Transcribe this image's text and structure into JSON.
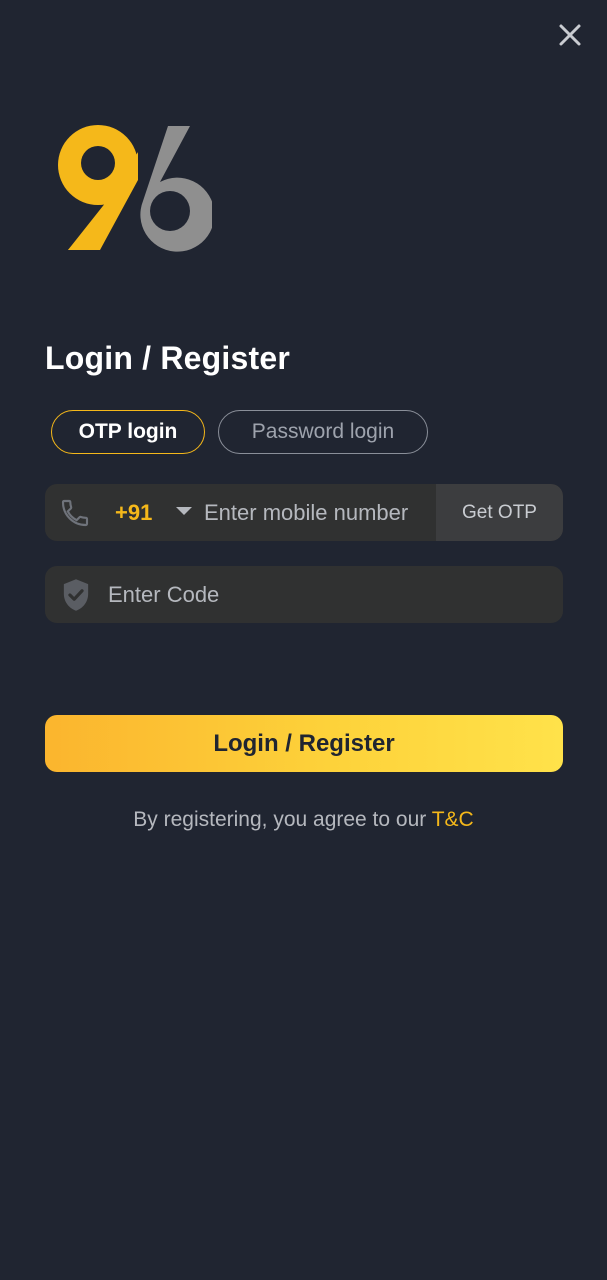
{
  "header": {
    "close_icon": "close-icon"
  },
  "brand": {
    "logo_text": "96",
    "accent_color": "#f5b81a",
    "secondary_color": "#8f8f8f"
  },
  "title": "Login / Register",
  "tabs": [
    {
      "label": "OTP login",
      "active": true
    },
    {
      "label": "Password login",
      "active": false
    }
  ],
  "phone_field": {
    "icon": "phone-icon",
    "country_code": "+91",
    "placeholder": "Enter mobile number",
    "get_otp_label": "Get OTP"
  },
  "code_field": {
    "icon": "shield-check-icon",
    "placeholder": "Enter Code"
  },
  "submit_label": "Login / Register",
  "terms": {
    "prefix": "By registering, you agree to our ",
    "link_label": "T&C"
  },
  "colors": {
    "background": "#202531",
    "field_background": "#303131",
    "button_gradient_start": "#fbb52e",
    "button_gradient_end": "#ffe24a"
  }
}
